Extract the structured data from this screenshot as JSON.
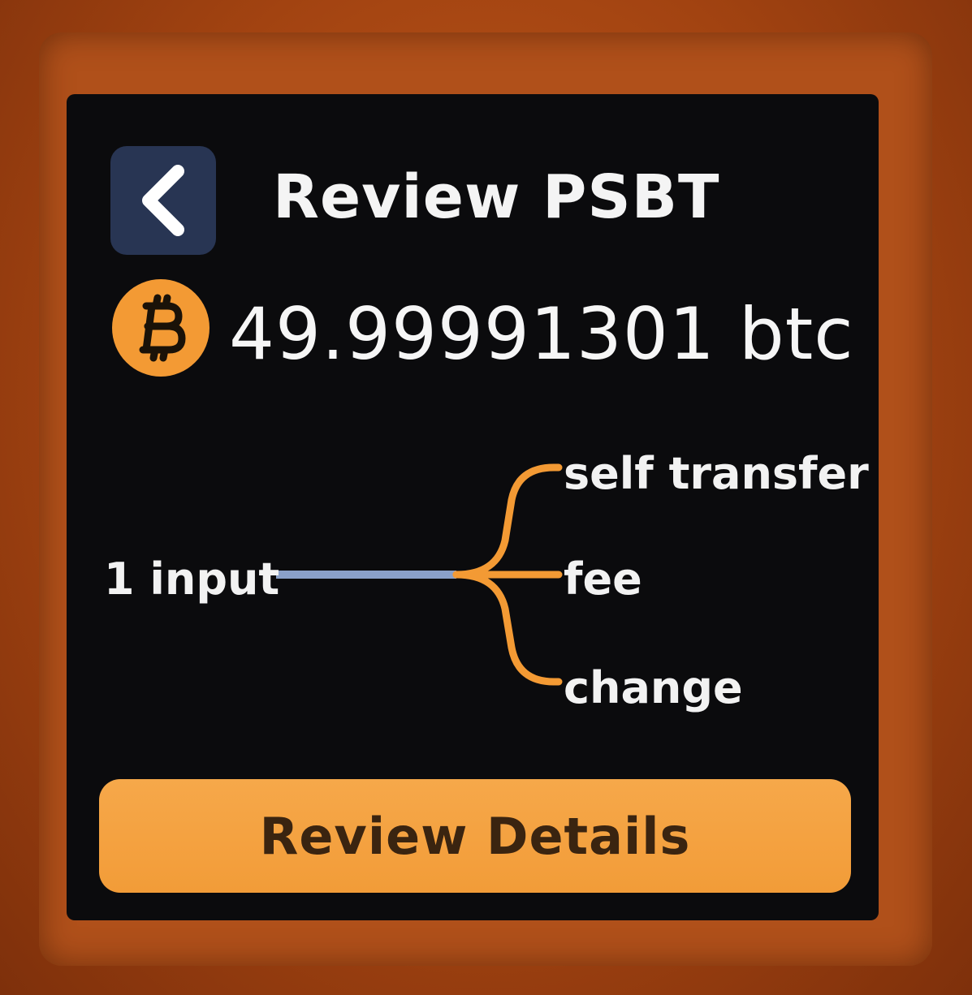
{
  "header": {
    "title": "Review PSBT",
    "back_icon": "chevron-left-icon"
  },
  "amount": {
    "icon": "bitcoin-icon",
    "value": "49.99991301 btc"
  },
  "flow": {
    "input_label": "1 input",
    "outputs": [
      "self transfer",
      "fee",
      "change"
    ]
  },
  "action": {
    "review_label": "Review Details"
  },
  "colors": {
    "accent": "#f39a34",
    "back_button_bg": "#283553",
    "input_line": "#8aa0c8",
    "screen_bg": "#0b0b0d",
    "button_text": "#3a2410"
  }
}
